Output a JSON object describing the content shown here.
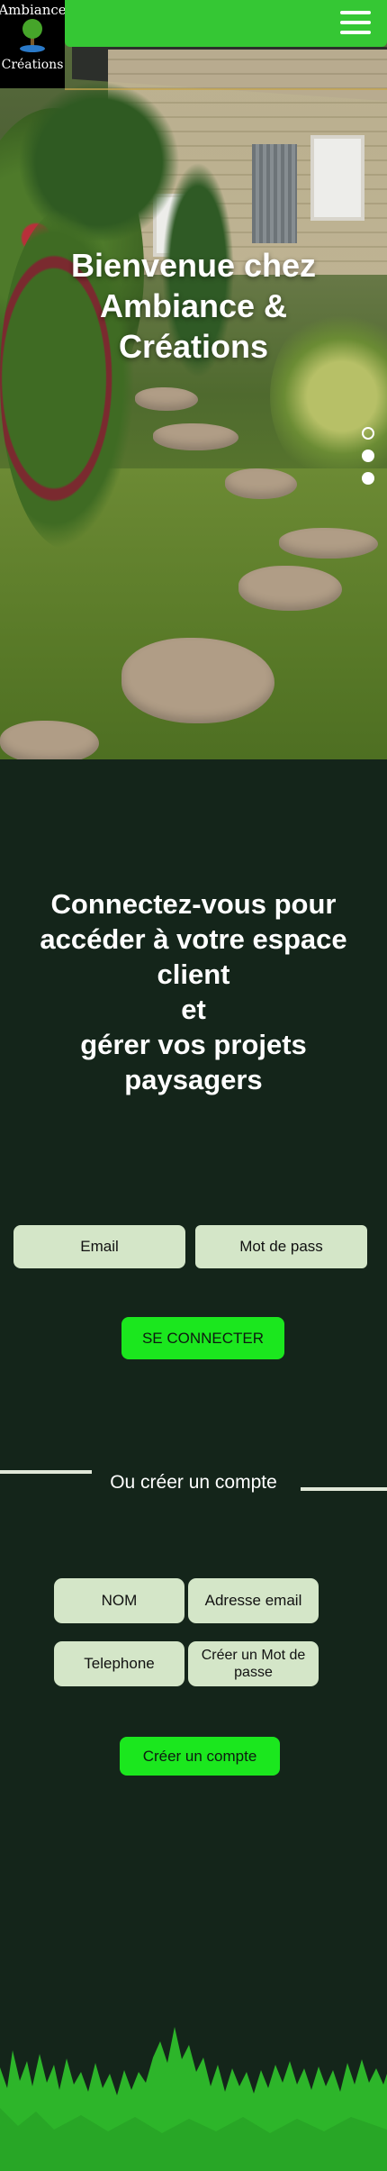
{
  "logo": {
    "line1": "Ambiance",
    "line2": "Créations"
  },
  "nav": {
    "menu_icon": "hamburger-icon"
  },
  "hero": {
    "title": "Bienvenue chez Ambiance & Créations",
    "slides": 3,
    "active_slide": 1
  },
  "login": {
    "title_lines": [
      "Connectez-vous pour accéder à votre espace client",
      "et",
      "gérer vos projets paysagers"
    ],
    "email_placeholder": "Email",
    "password_placeholder": "Mot de pass",
    "submit_label": "SE CONNECTER"
  },
  "register": {
    "divider_label": "Ou créer un compte",
    "name_placeholder": "NOM",
    "email_placeholder": "Adresse email",
    "phone_placeholder": "Telephone",
    "password_placeholder": "Créer un Mot de passe",
    "submit_label": "Créer un compte"
  },
  "colors": {
    "accent_green": "#1be71e",
    "nav_green": "#35c734",
    "field_bg": "#d4e6c8",
    "page_bg": "#14251a"
  }
}
